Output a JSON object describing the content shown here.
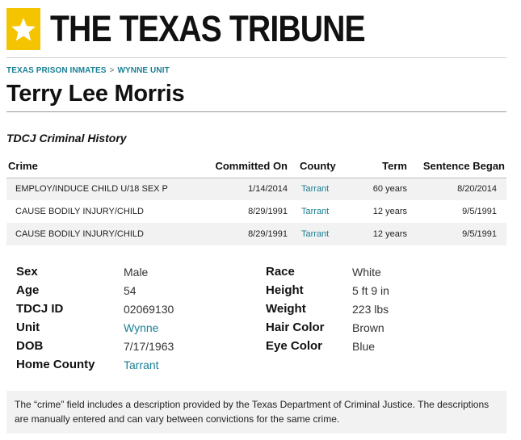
{
  "logo": {
    "text": "THE TEXAS TRIBUNE",
    "icon": "star-icon",
    "accent": "#f5c400"
  },
  "breadcrumb": {
    "parent": "TEXAS PRISON INMATES",
    "separator": ">",
    "current": "WYNNE UNIT"
  },
  "title": "Terry Lee Morris",
  "history": {
    "heading": "TDCJ Criminal History",
    "columns": {
      "crime": "Crime",
      "committed": "Committed On",
      "county": "County",
      "term": "Term",
      "began": "Sentence Began"
    },
    "rows": [
      {
        "crime": "EMPLOY/INDUCE CHILD U/18 SEX P",
        "committed": "1/14/2014",
        "county": "Tarrant",
        "term": "60 years",
        "began": "8/20/2014"
      },
      {
        "crime": "CAUSE BODILY INJURY/CHILD",
        "committed": "8/29/1991",
        "county": "Tarrant",
        "term": "12 years",
        "began": "9/5/1991"
      },
      {
        "crime": "CAUSE BODILY INJURY/CHILD",
        "committed": "8/29/1991",
        "county": "Tarrant",
        "term": "12 years",
        "began": "9/5/1991"
      }
    ]
  },
  "details": {
    "left": [
      {
        "label": "Sex",
        "value": "Male"
      },
      {
        "label": "Age",
        "value": "54"
      },
      {
        "label": "TDCJ ID",
        "value": "02069130"
      },
      {
        "label": "Unit",
        "value": "Wynne",
        "link": true
      },
      {
        "label": "DOB",
        "value": "7/17/1963"
      },
      {
        "label": "Home County",
        "value": "Tarrant",
        "link": true
      }
    ],
    "right": [
      {
        "label": "Race",
        "value": "White"
      },
      {
        "label": "Height",
        "value": "5 ft 9 in"
      },
      {
        "label": "Weight",
        "value": "223 lbs"
      },
      {
        "label": "Hair Color",
        "value": "Brown"
      },
      {
        "label": "Eye Color",
        "value": "Blue"
      }
    ]
  },
  "note": "The “crime” field includes a description provided by the Texas Department of Criminal Justice. The descriptions are manually entered and can vary between convictions for the same crime.",
  "colors": {
    "link": "#1a7f94",
    "row_alt": "#f2f2f2"
  }
}
